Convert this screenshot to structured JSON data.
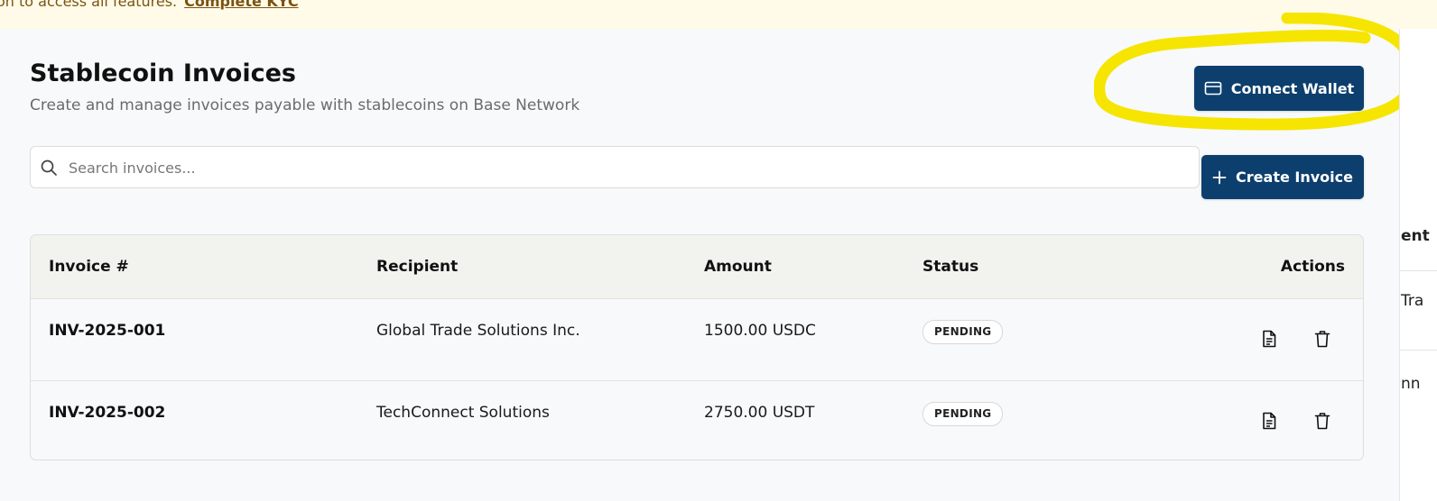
{
  "banner": {
    "text": "on to access all features.",
    "link_label": "Complete KYC"
  },
  "header": {
    "title": "Stablecoin Invoices",
    "subtitle": "Create and manage invoices payable with stablecoins on Base Network"
  },
  "actions": {
    "connect_wallet_label": "Connect Wallet",
    "create_invoice_label": "Create Invoice"
  },
  "search": {
    "placeholder": "Search invoices...",
    "value": ""
  },
  "table": {
    "columns": [
      "Invoice #",
      "Recipient",
      "Amount",
      "Status",
      "Actions"
    ],
    "rows": [
      {
        "invoice": "INV-2025-001",
        "recipient": "Global Trade Solutions Inc.",
        "amount": "1500.00 USDC",
        "status": "PENDING"
      },
      {
        "invoice": "INV-2025-002",
        "recipient": "TechConnect Solutions",
        "amount": "2750.00 USDT",
        "status": "PENDING"
      }
    ]
  },
  "right_panel_fragments": [
    "ent",
    "Tra",
    "nn"
  ],
  "colors": {
    "primary": "#0d3f6e",
    "banner_bg": "#fffbe8",
    "banner_text": "#7a5212",
    "highlight": "#f5e500",
    "page_bg": "#f8f9fa"
  },
  "icons": {
    "connect_wallet": "wallet-card-icon",
    "create_invoice": "plus-icon",
    "search": "search-icon",
    "view": "document-icon",
    "delete": "trash-icon"
  }
}
